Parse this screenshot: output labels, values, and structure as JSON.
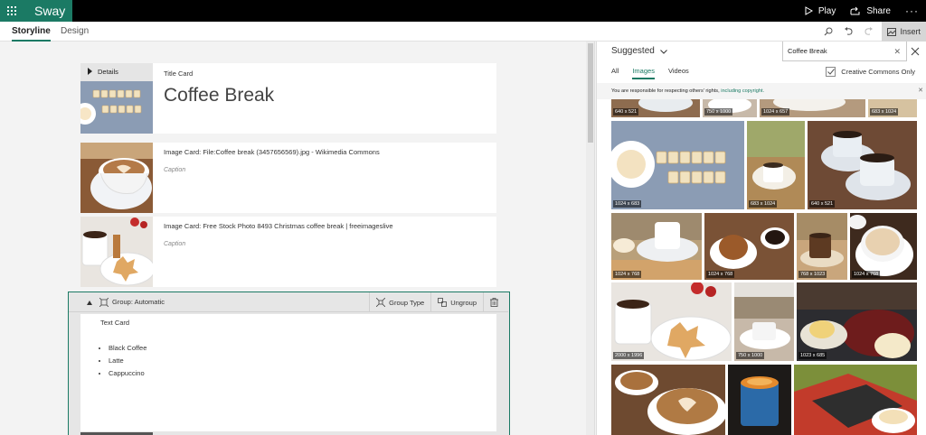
{
  "app": {
    "name": "Sway"
  },
  "topbar": {
    "play_label": "Play",
    "share_label": "Share",
    "more_label": "···"
  },
  "tabs": {
    "storyline": "Storyline",
    "design": "Design",
    "insert_label": "Insert"
  },
  "storyline": {
    "title_card": {
      "details_label": "Details",
      "type_label": "Title Card",
      "title": "Coffee Break"
    },
    "image_card_1": {
      "meta": "Image Card: File:Coffee break (3457656569).jpg - Wikimedia Commons",
      "caption": "Caption"
    },
    "image_card_2": {
      "meta": "Image Card: Free Stock Photo 8493 Christmas coffee break | freeimageslive",
      "caption": "Caption"
    },
    "group": {
      "label": "Group: Automatic",
      "group_type_label": "Group Type",
      "ungroup_label": "Ungroup"
    },
    "text_card": {
      "type_label": "Text Card",
      "items": [
        "Black Coffee",
        "Latte",
        "Cappuccino"
      ]
    }
  },
  "panel": {
    "suggested_label": "Suggested",
    "search_value": "Coffee Break",
    "tabs": [
      "All",
      "Images",
      "Videos"
    ],
    "creative_commons_label": "Creative Commons Only",
    "notice_text": "You are responsible for respecting others' rights,",
    "notice_link": "including copyright.",
    "images": {
      "top_row": [
        "640 x 521",
        "750 x 1000",
        "1024 x 657",
        "683 x 1024"
      ],
      "row1": [
        "1024 x 683",
        "683 x 1024",
        "640 x 521"
      ],
      "row2": [
        "1024 x 768",
        "1024 x 768",
        "768 x 1023",
        "1024 x 768"
      ],
      "row3": [
        "2000 x 1996",
        "750 x 1000",
        "1023 x 685"
      ]
    }
  },
  "colors": {
    "brand": "#1b7a64",
    "topbar": "#000000",
    "accent_link": "#1b7a64"
  }
}
